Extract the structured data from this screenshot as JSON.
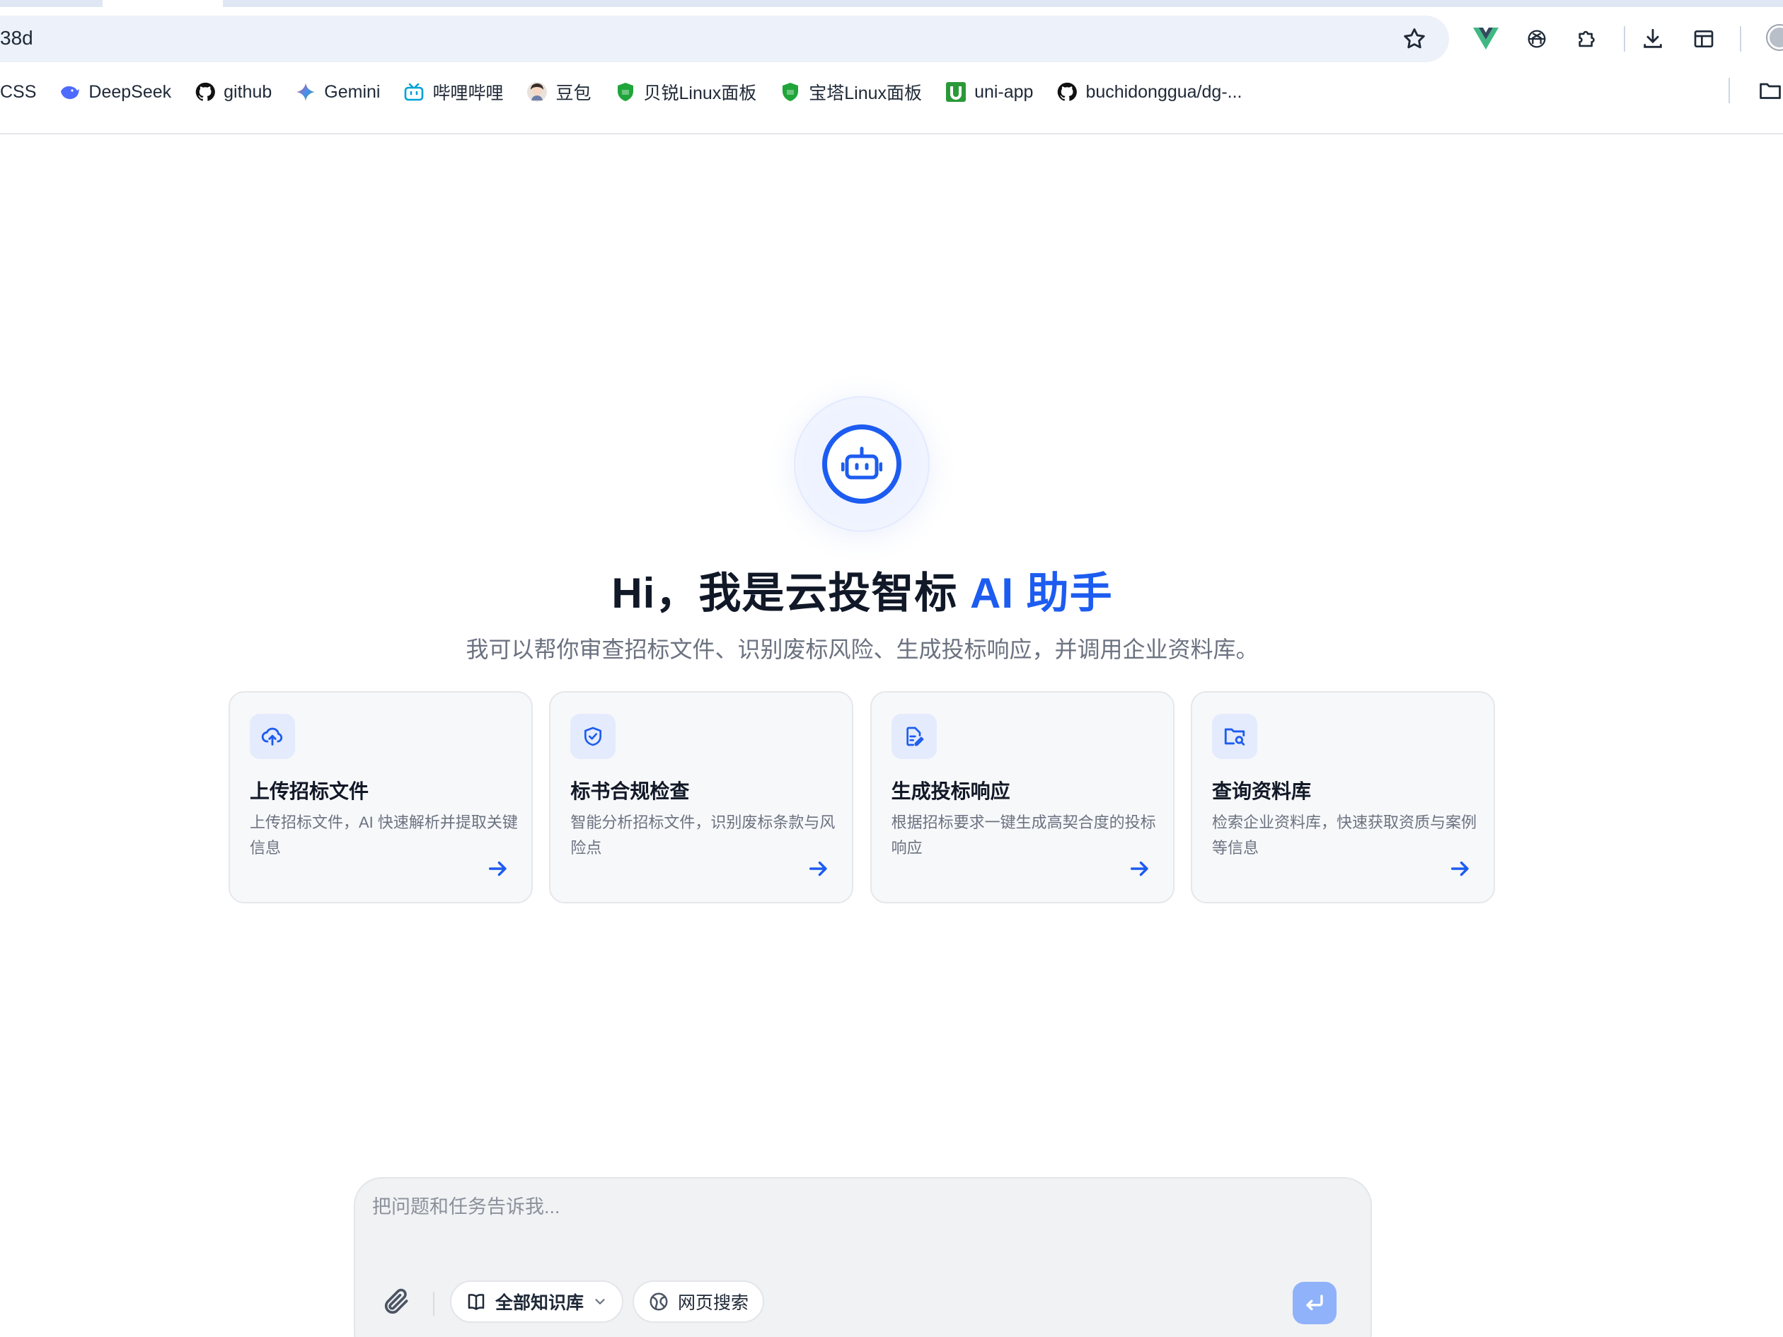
{
  "browser": {
    "url_text": "38d",
    "bookmarks": [
      {
        "label": "CSS",
        "icon": "bookmark-bar-icon"
      },
      {
        "label": "DeepSeek",
        "icon": "deepseek-whale-icon"
      },
      {
        "label": "github",
        "icon": "github-icon"
      },
      {
        "label": "Gemini",
        "icon": "gemini-sparkle-icon"
      },
      {
        "label": "哔哩哔哩",
        "icon": "bilibili-icon"
      },
      {
        "label": "豆包",
        "icon": "doubao-avatar-icon"
      },
      {
        "label": "贝锐Linux面板",
        "icon": "shield-green-icon"
      },
      {
        "label": "宝塔Linux面板",
        "icon": "shield-green-icon"
      },
      {
        "label": "uni-app",
        "icon": "uniapp-icon"
      },
      {
        "label": "buchidonggua/dg-...",
        "icon": "github-icon"
      }
    ]
  },
  "hero": {
    "title_prefix": "Hi，我是云投智标 ",
    "title_accent": "AI 助手",
    "subtitle": "我可以帮你审查招标文件、识别废标风险、生成投标响应，并调用企业资料库。"
  },
  "cards": [
    {
      "title": "上传招标文件",
      "desc": "上传招标文件，AI 快速解析并提取关键信息",
      "icon": "cloud-upload-icon"
    },
    {
      "title": "标书合规检查",
      "desc": "智能分析招标文件，识别废标条款与风险点",
      "icon": "shield-check-icon"
    },
    {
      "title": "生成投标响应",
      "desc": "根据招标要求一键生成高契合度的投标响应",
      "icon": "document-edit-icon"
    },
    {
      "title": "查询资料库",
      "desc": "检索企业资料库，快速获取资质与案例等信息",
      "icon": "folder-search-icon"
    }
  ],
  "composer": {
    "placeholder": "把问题和任务告诉我...",
    "knowledge_label": "全部知识库",
    "web_search_label": "网页搜索"
  },
  "colors": {
    "accent": "#1d5cf0",
    "send_button": "#8fb2fb",
    "card_bg": "#f7f8fa"
  }
}
